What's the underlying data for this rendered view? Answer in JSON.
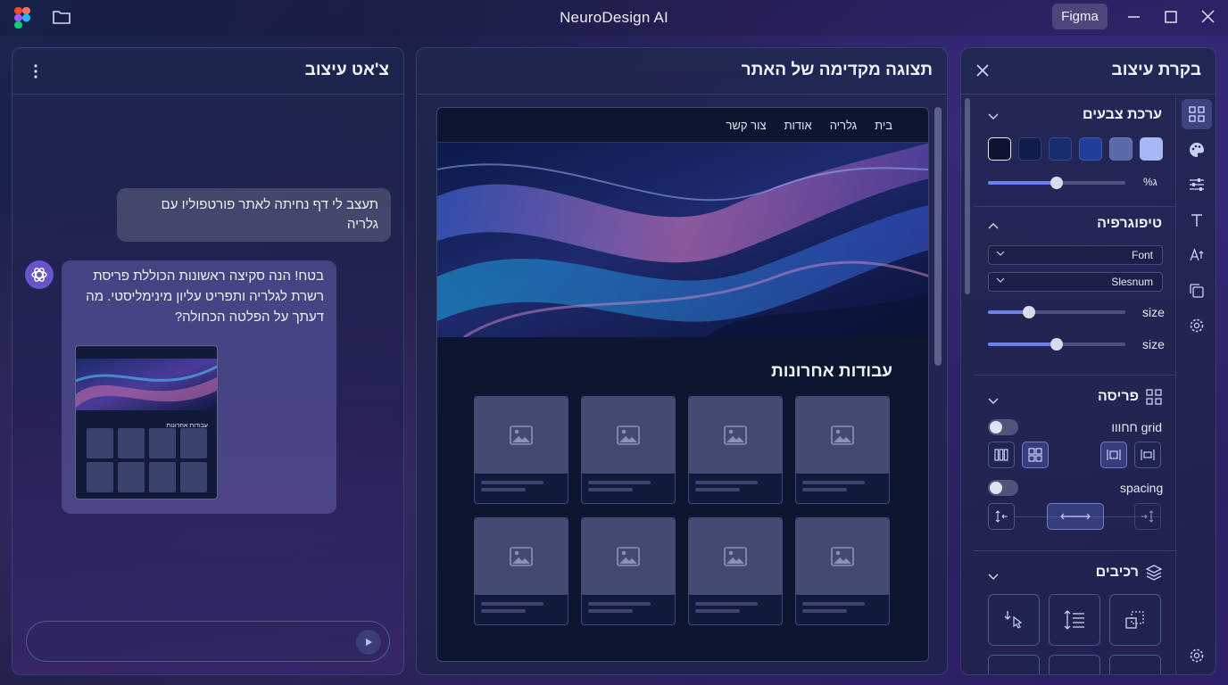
{
  "app": {
    "title": "NeuroDesign AI",
    "figma_label": "Figma"
  },
  "chat": {
    "title": "צ'אט עיצוב",
    "user_message": "תעצב לי דף נחיתה לאתר פורטפוליו עם גלריה",
    "ai_message": "בטח! הנה סקיצה ראשונות הכוללת פריסת רשרת לגלריה ותפריט עליון מינימליסטי. מה דעתך על הפלטה הכחולה?",
    "thumbnail_title": "עבודות אחרונות",
    "input_placeholder": ""
  },
  "preview": {
    "title": "תצוגה מקדימה של האתר",
    "nav": [
      "בית",
      "גלריה",
      "אודות",
      "צור קשר"
    ],
    "section_title": "עבודות אחרונות"
  },
  "design": {
    "title": "בקרת עיצוב",
    "palette": {
      "title": "ערכת צבעים",
      "swatches": [
        "#0b1330",
        "#0f1e4a",
        "#142e6e",
        "#1f3f9a",
        "#5a6aa8",
        "#a8b8f5"
      ],
      "slider_label": "%ג",
      "slider_value": 0.5
    },
    "typography": {
      "title": "טיפוגרפיה",
      "font_dropdown": "Font",
      "style_dropdown": "Slesnum",
      "size_label_1": "size",
      "size_value_1": 0.3,
      "size_label_2": "size",
      "size_value_2": 0.5
    },
    "layout": {
      "title": "פריסה",
      "grid_label": "grid חחווו",
      "spacing_label": "spacing"
    },
    "components": {
      "title": "רכיבים"
    }
  },
  "colors": {
    "accent": "#6a82e8",
    "panel_bg": "#1e284e"
  }
}
